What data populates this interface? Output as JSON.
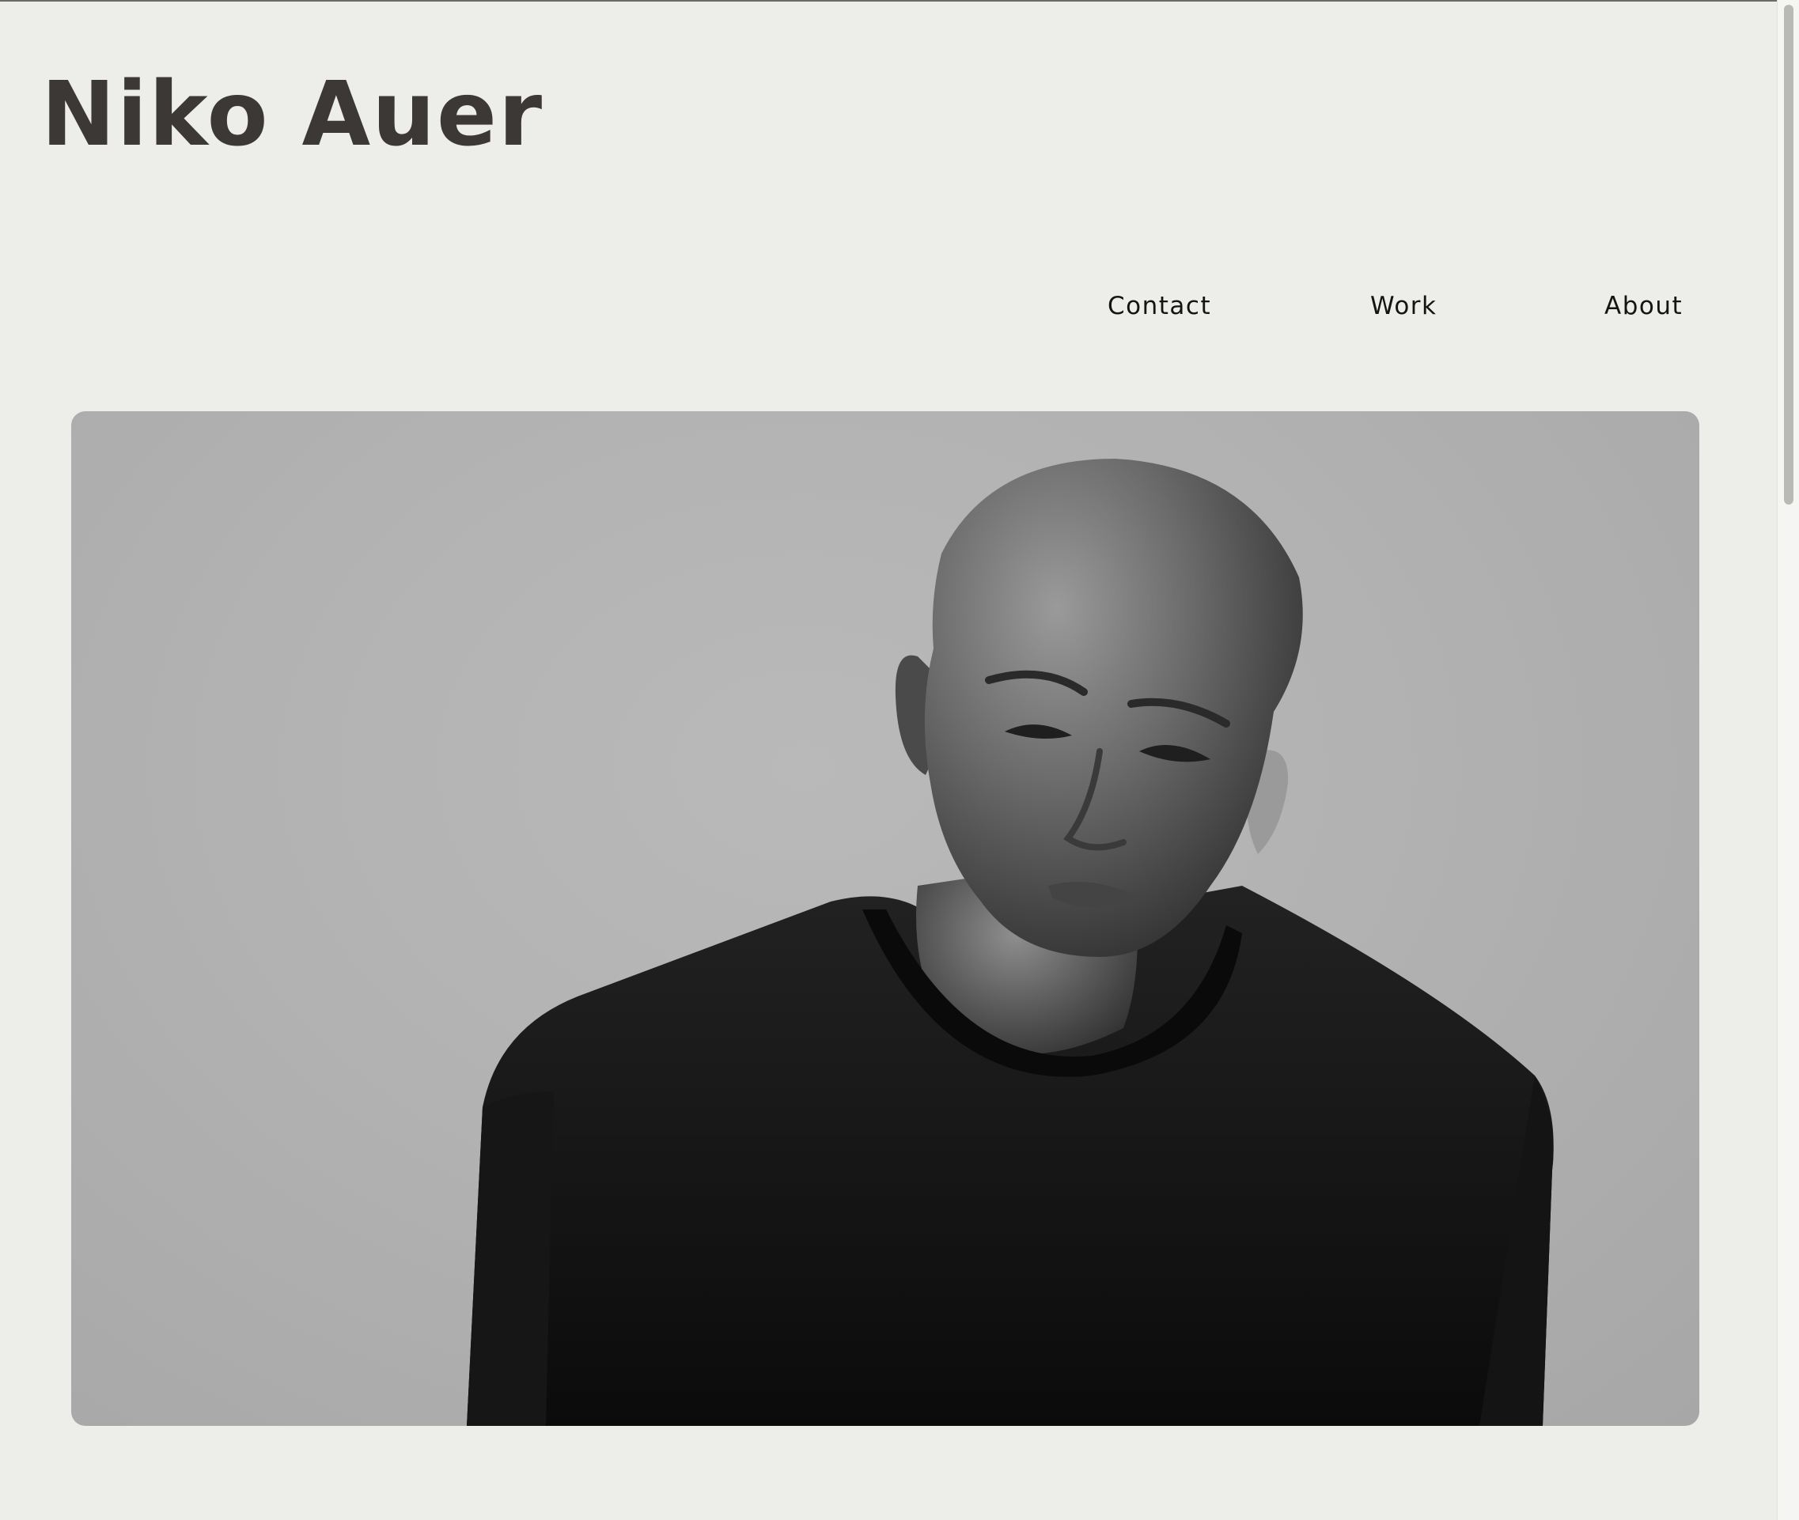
{
  "site": {
    "title": "Niko Auer"
  },
  "nav": {
    "items": [
      "Contact",
      "Work",
      "About"
    ]
  },
  "hero": {
    "icon": "portrait-photo-icon"
  },
  "colors": {
    "background": "#edede9",
    "title": "#3c3836",
    "nav_text": "#141414",
    "photo_backdrop": "#b2b2b2"
  }
}
